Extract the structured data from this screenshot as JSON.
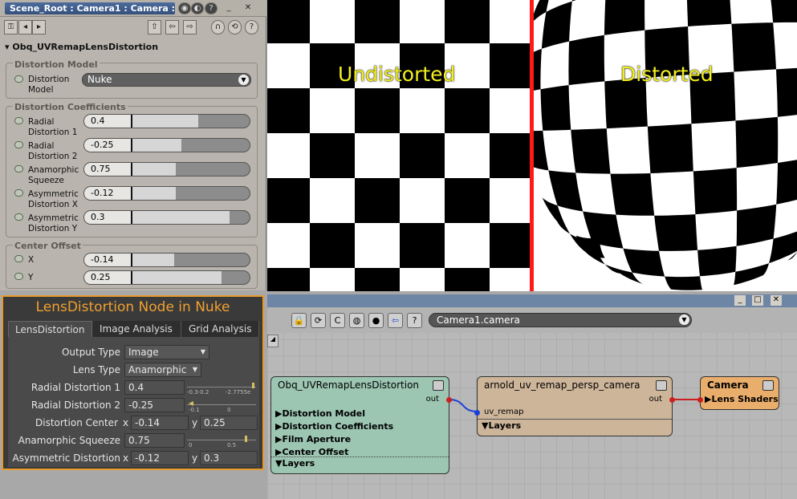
{
  "property_panel": {
    "title": "Scene_Root : Camera1 : Camera : ...",
    "node_name": "Obq_UVRemapLensDistortion",
    "distortion_model": {
      "group_title": "Distortion Model",
      "label_line1": "Distortion",
      "label_line2": "Model",
      "value": "Nuke"
    },
    "coefficients": {
      "group_title": "Distortion Coefficients",
      "items": [
        {
          "label1": "Radial",
          "label2": "Distortion 1",
          "value": "0.4",
          "fill": 0.57
        },
        {
          "label1": "Radial",
          "label2": "Distortion 2",
          "value": "-0.25",
          "fill": 0.43
        },
        {
          "label1": "Anamorphic",
          "label2": "Squeeze",
          "value": "0.75",
          "fill": 0.38
        },
        {
          "label1": "Asymmetric",
          "label2": "Distortion X",
          "value": "-0.12",
          "fill": 0.38
        },
        {
          "label1": "Asymmetric",
          "label2": "Distortion Y",
          "value": "0.3",
          "fill": 0.84
        }
      ]
    },
    "center_offset": {
      "group_title": "Center Offset",
      "items": [
        {
          "label": "X",
          "value": "-0.14",
          "fill": 0.37
        },
        {
          "label": "Y",
          "value": "0.25",
          "fill": 0.77
        }
      ]
    }
  },
  "viewport": {
    "undistorted_label": "Undistorted",
    "distorted_label": "Distorted"
  },
  "render_tree": {
    "camera_select": "Camera1.camera",
    "nodes": {
      "lens": {
        "title": "Obq_UVRemapLensDistortion",
        "out_label": "out",
        "rows": [
          "Distortion Model",
          "Distortion Coefficients",
          "Film Aperture",
          "Center Offset"
        ],
        "layers": "Layers"
      },
      "remap": {
        "title": "arnold_uv_remap_persp_camera",
        "out_label": "out",
        "in_label": "uv_remap",
        "layers": "Layers"
      },
      "camera": {
        "title": "Camera",
        "row": "Lens Shaders"
      }
    },
    "colors": {
      "lens": "#9cc5b2",
      "remap": "#cdb59a",
      "camera": "#e9ad6c"
    }
  },
  "nuke": {
    "title": "LensDistortion Node in Nuke",
    "tabs": [
      "LensDistortion",
      "Image Analysis",
      "Grid Analysis"
    ],
    "output_type": {
      "label": "Output Type",
      "value": "Image"
    },
    "lens_type": {
      "label": "Lens Type",
      "value": "Anamorphic"
    },
    "radial1": {
      "label": "Radial Distortion 1",
      "value": "0.4",
      "ticks": [
        "-0.3-0.2",
        "-2.7755e"
      ]
    },
    "radial2": {
      "label": "Radial Distortion 2",
      "value": "-0.25",
      "ticks": [
        "-0.1",
        "0"
      ]
    },
    "center": {
      "label": "Distortion Center",
      "x_label": "x",
      "x": "-0.14",
      "y_label": "y",
      "y": "0.25"
    },
    "squeeze": {
      "label": "Anamorphic Squeeze",
      "value": "0.75",
      "ticks": [
        "0",
        "0.5"
      ]
    },
    "asym": {
      "label": "Asymmetric Distortion",
      "x_label": "x",
      "x": "-0.12",
      "y_label": "y",
      "y": "0.3"
    }
  }
}
